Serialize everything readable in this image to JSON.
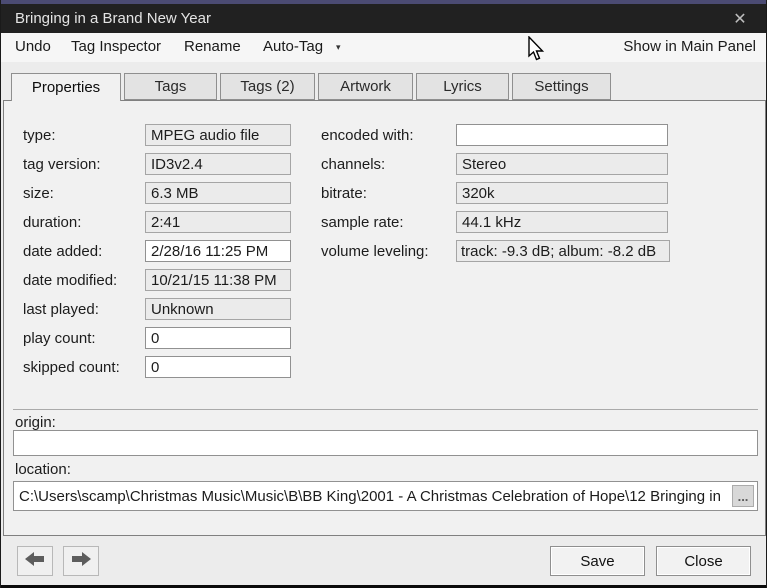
{
  "window": {
    "title": "Bringing in a Brand New Year"
  },
  "icons": {
    "close": "✕",
    "dropdown": "▾"
  },
  "menu": {
    "items": [
      "Undo",
      "Tag Inspector",
      "Rename",
      "Auto-Tag"
    ],
    "right_action": "Show in Main Panel"
  },
  "tabs": [
    {
      "label": "Properties",
      "active": true
    },
    {
      "label": "Tags",
      "active": false
    },
    {
      "label": "Tags (2)",
      "active": false
    },
    {
      "label": "Artwork",
      "active": false
    },
    {
      "label": "Lyrics",
      "active": false
    },
    {
      "label": "Settings",
      "active": false
    }
  ],
  "fields": {
    "left": [
      {
        "label": "type:",
        "value": "MPEG audio file",
        "editable": false
      },
      {
        "label": "tag version:",
        "value": "ID3v2.4",
        "editable": false
      },
      {
        "label": "size:",
        "value": "6.3 MB",
        "editable": false
      },
      {
        "label": "duration:",
        "value": "2:41",
        "editable": false
      },
      {
        "label": "date added:",
        "value": "2/28/16 11:25 PM",
        "editable": true
      },
      {
        "label": "date modified:",
        "value": "10/21/15 11:38 PM",
        "editable": false
      },
      {
        "label": "last played:",
        "value": "Unknown",
        "editable": false
      },
      {
        "label": "play count:",
        "value": "0",
        "editable": true
      },
      {
        "label": "skipped count:",
        "value": "0",
        "editable": true
      }
    ],
    "right": [
      {
        "label": "encoded with:",
        "value": "",
        "editable": true
      },
      {
        "label": "channels:",
        "value": "Stereo",
        "editable": false
      },
      {
        "label": "bitrate:",
        "value": "320k",
        "editable": false
      },
      {
        "label": "sample rate:",
        "value": "44.1 kHz",
        "editable": false
      },
      {
        "label": "volume leveling:",
        "value": "track: -9.3 dB; album: -8.2 dB",
        "editable": false
      }
    ]
  },
  "origin": {
    "label": "origin:",
    "value": ""
  },
  "location": {
    "label": "location:",
    "value": "C:\\Users\\scamp\\Christmas Music\\Music\\B\\BB King\\2001 - A Christmas Celebration of Hope\\12 Bringing in ",
    "browse_label": "..."
  },
  "footer": {
    "save_label": "Save",
    "close_label": "Close"
  },
  "colors": {
    "accent_top": "#4b4b73",
    "titlebar_bg": "#212121",
    "panel_bg": "#f1f1f1",
    "readonly_field_bg": "#ebebeb",
    "editable_field_bg": "#ffffff"
  }
}
